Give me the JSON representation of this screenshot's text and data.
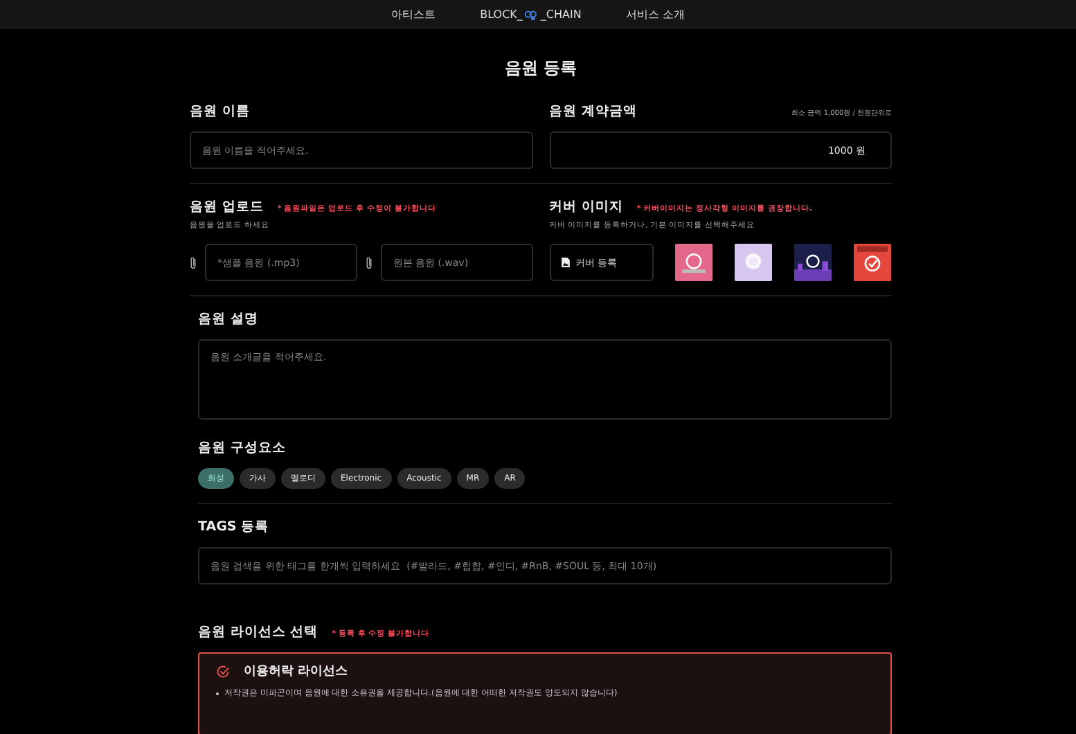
{
  "nav": {
    "items": [
      {
        "kind": "text",
        "label": "아티스트"
      },
      {
        "kind": "logo",
        "label": "BLOCK_",
        "label_after": "_CHAIN"
      },
      {
        "kind": "text",
        "label": "서비스 소개"
      }
    ]
  },
  "title": "음원 등록",
  "name_field": {
    "label": "음원 이름",
    "placeholder": "음원 이름을 적어주세요."
  },
  "price_field": {
    "label": "음원 계약금액",
    "hint": "최소 금액 1,000원 / 천원단위로",
    "value": "1000 원"
  },
  "upload": {
    "label": "음원 업로드",
    "warning": "* 음원파일은 업로드 후 수정이 불가합니다",
    "description": "음원을 업로드 하세요",
    "files": [
      {
        "placeholder": "*샘플 음원 (.mp3)"
      },
      {
        "placeholder": "원본 음원 (.wav)"
      }
    ]
  },
  "cover": {
    "label": "커버 이미지",
    "warning": "* 커버이미지는 정사각형 이미지를 권장합니다.",
    "description": "커버 이미지를 등록하거나, 기본 이미지를 선택해주세요",
    "button": "커버 등록",
    "images": [
      {
        "kind": "pink"
      },
      {
        "kind": "lilac"
      },
      {
        "kind": "city"
      },
      {
        "kind": "red"
      }
    ]
  },
  "description": {
    "label": "음원 설명",
    "placeholder": "음원 소개글을 적어주세요."
  },
  "components": {
    "label": "음원 구성요소",
    "chips": [
      {
        "label": "화성",
        "selected": true
      },
      {
        "label": "가사",
        "selected": false
      },
      {
        "label": "멜로디",
        "selected": false
      },
      {
        "label": "Electronic",
        "selected": false
      },
      {
        "label": "Acoustic",
        "selected": false
      },
      {
        "label": "MR",
        "selected": false
      },
      {
        "label": "AR",
        "selected": false
      }
    ]
  },
  "tags": {
    "label": "TAGS 등록",
    "placeholder": "음원 검색을 위한 태그를 한개씩 입력하세요  (#발라드, #힙합, #인디, #RnB, #SOUL 등, 최대 10개)"
  },
  "license": {
    "label": "음원 라이선스 선택",
    "warning": "* 등록 후 수정 불가합니다",
    "options": [
      {
        "title": "이용허락 라이선스",
        "selected": true,
        "bullets": [
          "저작권은 미파곤이며 음원에 대한 소유권을 제공합니다.(음원에 대한 어떠한 저작권도 양도되지 않습니다)"
        ]
      }
    ]
  }
}
